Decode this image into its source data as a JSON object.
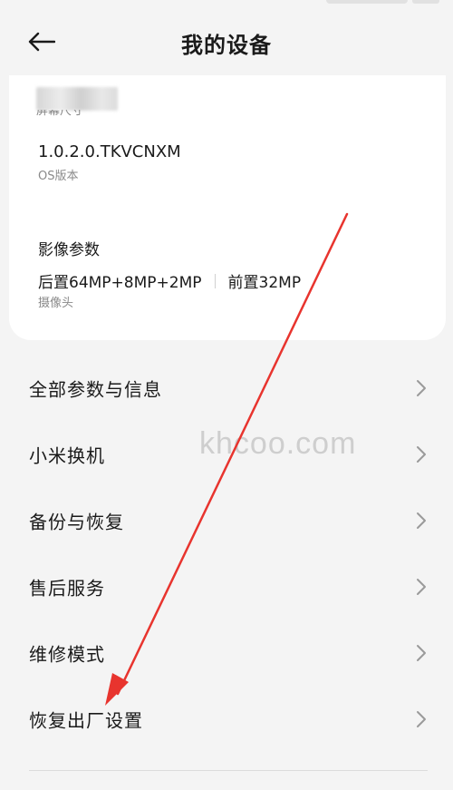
{
  "header": {
    "title": "我的设备"
  },
  "device_info": {
    "cut_label": "屏幕尺寸",
    "os": {
      "value": "1.0.2.0.TKVCNXM",
      "label": "OS版本"
    },
    "camera_section_title": "影像参数",
    "camera": {
      "rear": "后置64MP+8MP+2MP",
      "front": "前置32MP",
      "label": "摄像头"
    }
  },
  "menu": {
    "items": [
      {
        "label": "全部参数与信息"
      },
      {
        "label": "小米换机"
      },
      {
        "label": "备份与恢复"
      },
      {
        "label": "售后服务"
      },
      {
        "label": "维修模式"
      },
      {
        "label": "恢复出厂设置"
      }
    ]
  },
  "watermark": "khcoo.com",
  "colors": {
    "background": "#f4f4f4",
    "card": "#ffffff",
    "arrow": "#e8342e"
  }
}
